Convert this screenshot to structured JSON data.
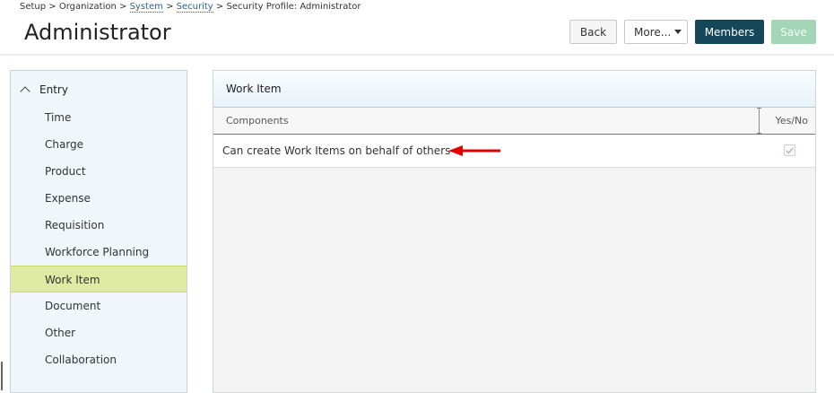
{
  "breadcrumb": {
    "setup": "Setup",
    "organization": "Organization",
    "system": "System",
    "security": "Security",
    "current": "Security Profile: Administrator",
    "separator": ">"
  },
  "page": {
    "title": "Administrator"
  },
  "toolbar": {
    "back_label": "Back",
    "more_label": "More...",
    "members_label": "Members",
    "save_label": "Save"
  },
  "sidebar": {
    "section_label": "Entry",
    "items": [
      {
        "label": "Time"
      },
      {
        "label": "Charge"
      },
      {
        "label": "Product"
      },
      {
        "label": "Expense"
      },
      {
        "label": "Requisition"
      },
      {
        "label": "Workforce Planning"
      },
      {
        "label": "Work Item"
      },
      {
        "label": "Document"
      },
      {
        "label": "Other"
      },
      {
        "label": "Collaboration"
      }
    ],
    "active_item": "Work Item"
  },
  "panel": {
    "title": "Work Item",
    "columns": {
      "components": "Components",
      "yes_no": "Yes/No"
    },
    "rows": [
      {
        "label": "Can create Work Items on behalf of others",
        "checked": true
      }
    ]
  },
  "colors": {
    "members_button": "#14475a",
    "save_button_disabled": "#a3d6b8",
    "active_sidebar_item": "#dfeaa3",
    "annotation_arrow": "#e00000",
    "link": "#2a6496"
  },
  "icons": {
    "collapse": "chevron-up-icon",
    "more": "caret-down-icon",
    "checkbox": "check-icon",
    "annotation": "arrow-left-icon"
  }
}
